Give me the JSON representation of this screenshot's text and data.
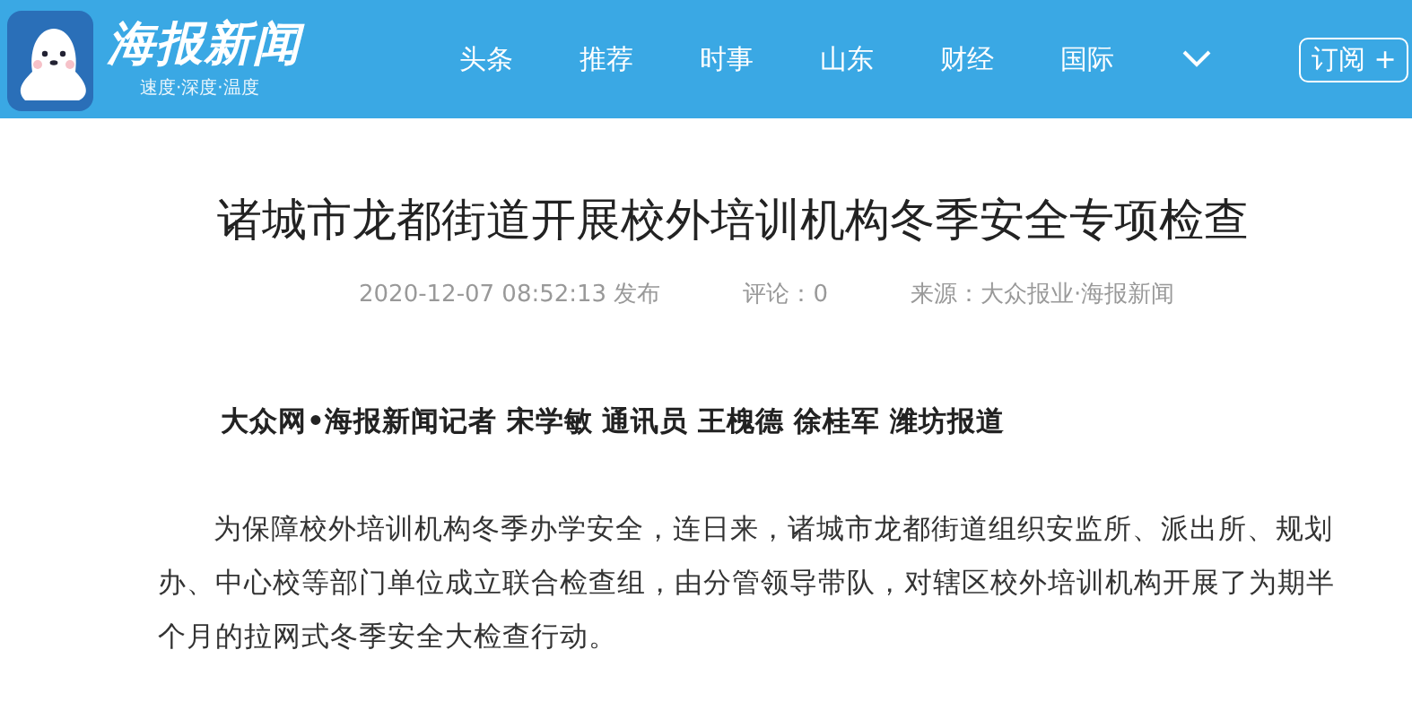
{
  "header": {
    "logo_text": "海报新闻",
    "slogan": "速度·深度·温度",
    "nav": [
      {
        "label": "头条"
      },
      {
        "label": "推荐"
      },
      {
        "label": "时事"
      },
      {
        "label": "山东"
      },
      {
        "label": "财经"
      },
      {
        "label": "国际"
      }
    ],
    "subscribe_button": "订阅 +"
  },
  "article": {
    "title": "诸城市龙都街道开展校外培训机构冬季安全专项检查",
    "published": "2020-12-07 08:52:13 发布",
    "comments": "评论：0",
    "source": "来源：大众报业·海报新闻",
    "byline": "大众网•海报新闻记者 宋学敏 通讯员 王槐德 徐桂军 潍坊报道",
    "paragraphs": [
      "为保障校外培训机构冬季办学安全，连日来，诸城市龙都街道组织安监所、派出所、规划办、中心校等部门单位成立联合检查组，由分管领导带队，对辖区校外培训机构开展了为期半个月的拉网式冬季安全大检查行动。"
    ]
  }
}
